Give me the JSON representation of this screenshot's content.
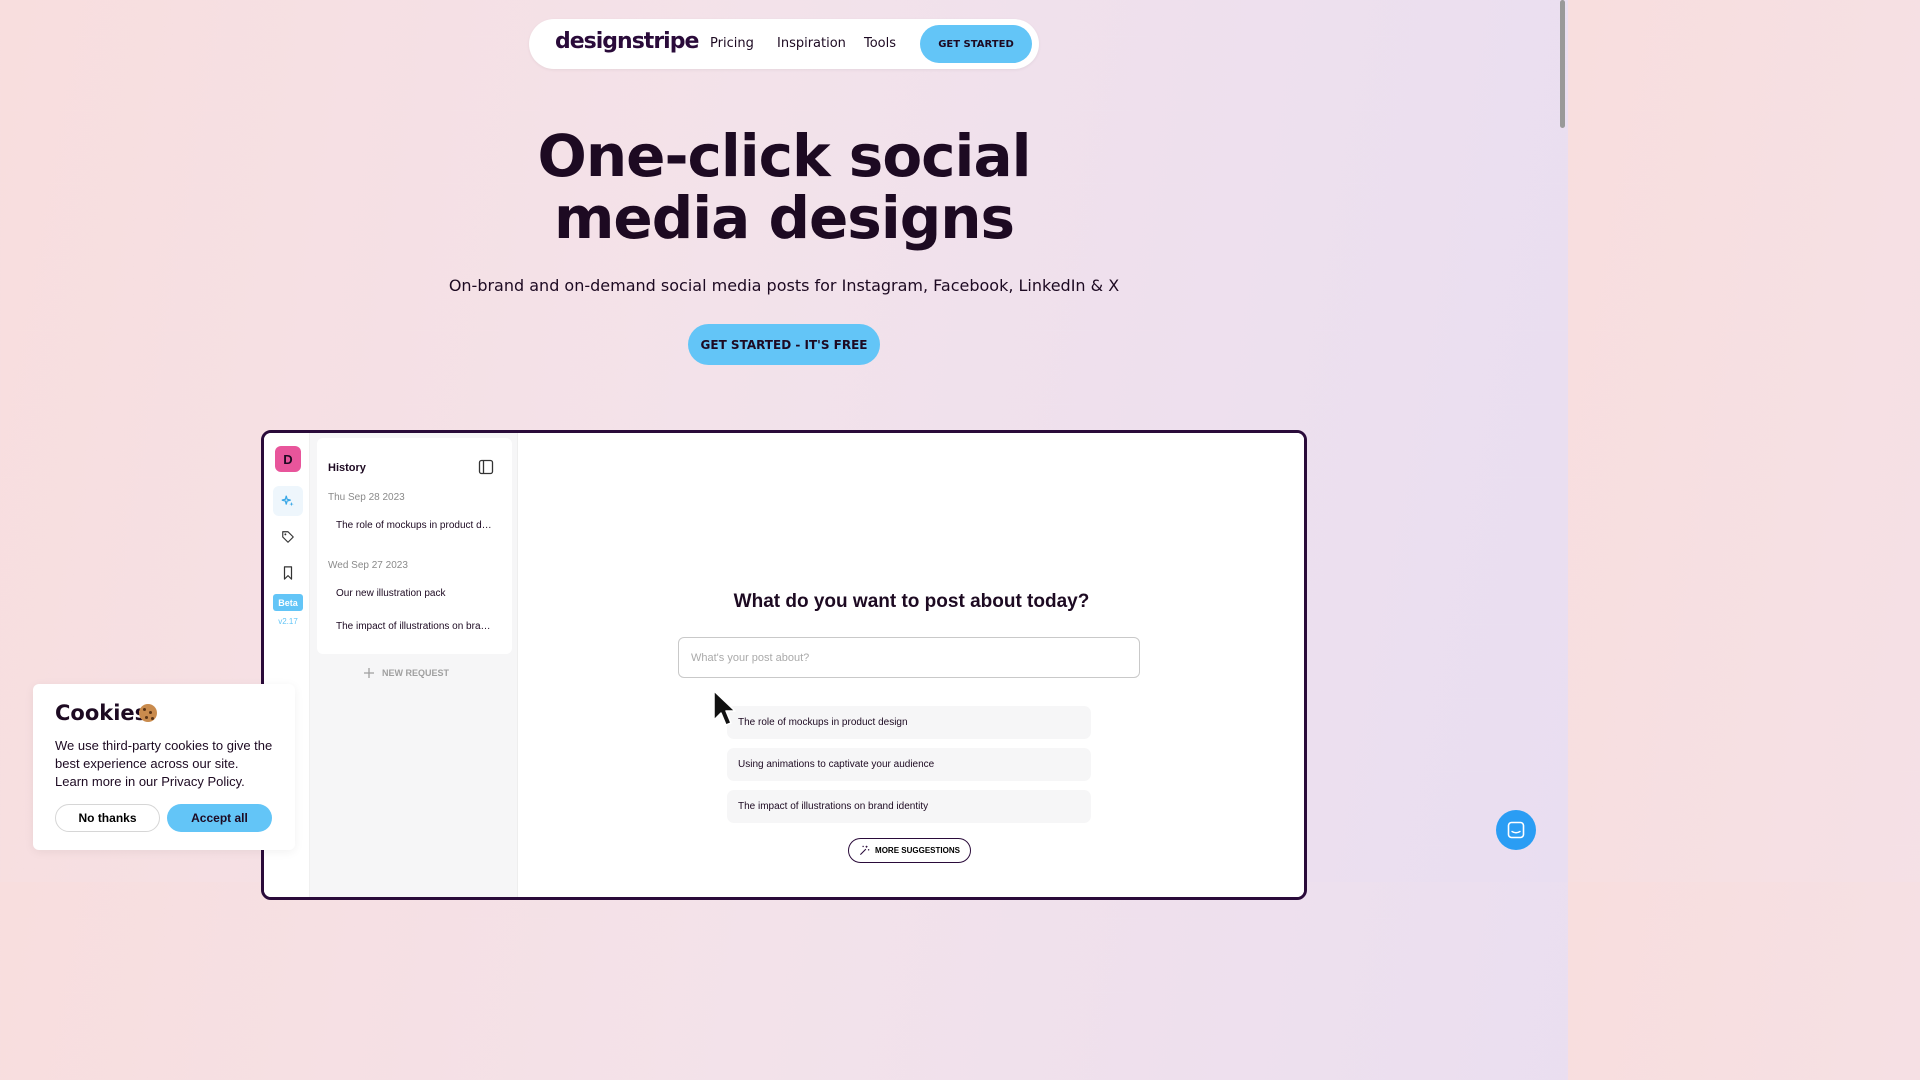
{
  "nav": {
    "logo": "designstripe",
    "links": [
      "Pricing",
      "Inspiration",
      "Tools"
    ],
    "cta": "GET STARTED"
  },
  "hero": {
    "title_line1": "One-click social",
    "title_line2": "media designs",
    "subtitle": "On-brand and on-demand social media posts for Instagram, Facebook, LinkedIn & X",
    "cta": "GET STARTED - IT'S FREE"
  },
  "app": {
    "avatar_letter": "D",
    "beta_label": "Beta",
    "version": "v2.17",
    "history": {
      "title": "History",
      "groups": [
        {
          "date": "Thu Sep 28 2023",
          "items": [
            "The role of mockups in product design"
          ]
        },
        {
          "date": "Wed Sep 27 2023",
          "items": [
            "Our new illustration pack",
            "The impact of illustrations on brand identity"
          ]
        }
      ],
      "new_request": "NEW REQUEST"
    },
    "main": {
      "question": "What do you want to post about today?",
      "input_placeholder": "What's your post about?",
      "suggestions": [
        "The role of mockups in product design",
        "Using animations to captivate your audience",
        "The impact of illustrations on brand identity"
      ],
      "more_suggestions": "MORE SUGGESTIONS"
    }
  },
  "cookie": {
    "title": "Cookies",
    "text": "We use third-party cookies to give the best experience across our site. Learn more in our Privacy Policy.",
    "no_label": "No thanks",
    "yes_label": "Accept all"
  },
  "colors": {
    "accent": "#63c5f7",
    "dark": "#1d0a22",
    "avatar": "#e8559b",
    "chat": "#2a9df4"
  },
  "icons": [
    "sparkle-icon",
    "tag-icon",
    "bookmark-icon",
    "sidebar-toggle-icon",
    "plus-icon",
    "magic-wand-icon",
    "chat-icon",
    "cookie-icon"
  ]
}
